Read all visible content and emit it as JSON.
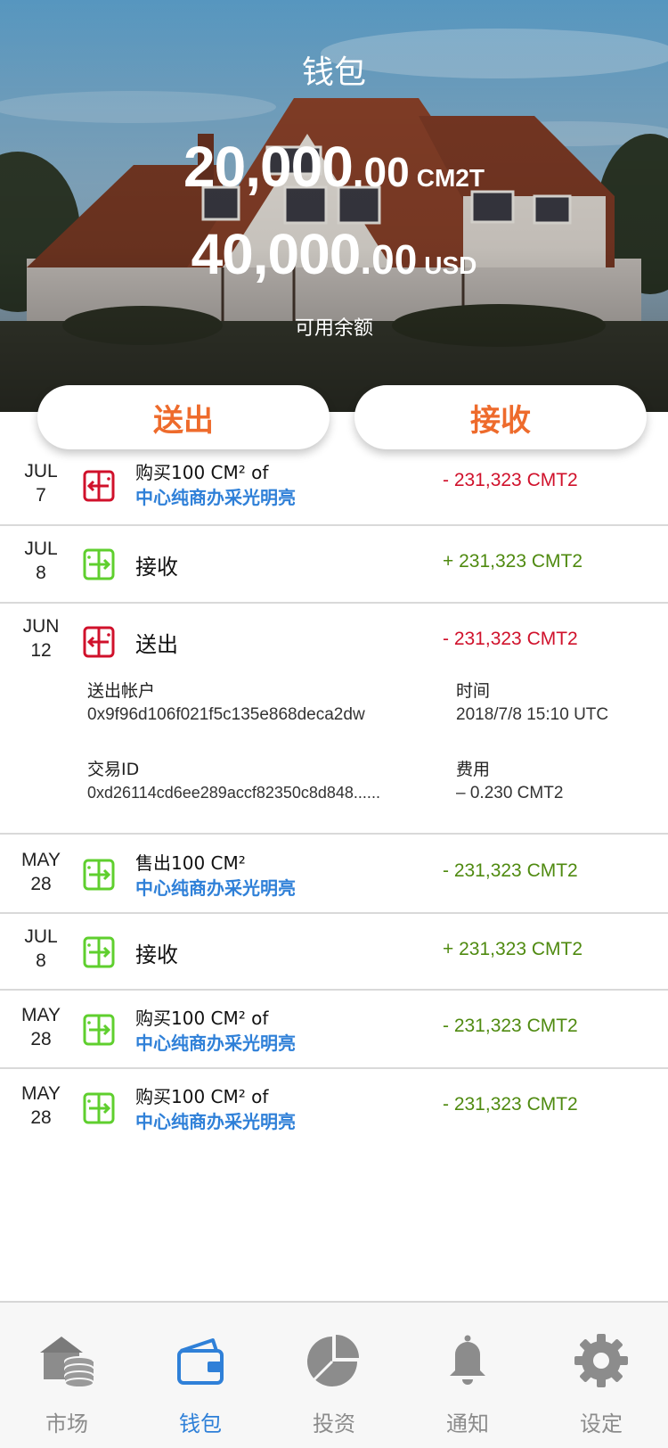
{
  "header": {
    "title": "钱包",
    "balance_token_int": "20,000",
    "balance_token_dec": ".00",
    "balance_token_unit": "CM2T",
    "balance_usd_int": "40,000",
    "balance_usd_dec": ".00",
    "balance_usd_unit": "USD",
    "subtitle": "可用余额"
  },
  "actions": {
    "send_label": "送出",
    "receive_label": "接收"
  },
  "transactions": [
    {
      "month": "JUL",
      "day": "7",
      "type": "send",
      "title": "购买100 CM² of",
      "subtitle": "中心纯商办采光明亮",
      "amount": "- 231,323 CMT2",
      "color": "#d0112b"
    },
    {
      "month": "JUL",
      "day": "8",
      "type": "receive",
      "title": "接收",
      "subtitle": "",
      "amount": "+ 231,323 CMT2",
      "color": "#4f8a10"
    },
    {
      "month": "JUN",
      "day": "12",
      "type": "send",
      "title": "送出",
      "subtitle": "",
      "amount": "- 231,323 CMT2",
      "color": "#d0112b",
      "details": {
        "from_label": "送出帐户",
        "from_value": "0x9f96d106f021f5c135e868deca2dw",
        "time_label": "时间",
        "time_value": "2018/7/8 15:10 UTC",
        "txid_label": "交易ID",
        "txid_value": "0xd26114cd6ee289accf82350c8d848......",
        "fee_label": "费用",
        "fee_value": "– 0.230 CMT2"
      }
    },
    {
      "month": "MAY",
      "day": "28",
      "type": "receive",
      "title": "售出100 CM²",
      "subtitle": "中心纯商办采光明亮",
      "amount": "- 231,323 CMT2",
      "color": "#4f8a10"
    },
    {
      "month": "JUL",
      "day": "8",
      "type": "receive",
      "title": "接收",
      "subtitle": "",
      "amount": "+ 231,323 CMT2",
      "color": "#4f8a10"
    },
    {
      "month": "MAY",
      "day": "28",
      "type": "receive",
      "title": "购买100 CM² of",
      "subtitle": "中心纯商办采光明亮",
      "amount": "- 231,323 CMT2",
      "color": "#4f8a10"
    },
    {
      "month": "MAY",
      "day": "28",
      "type": "receive",
      "title": "购买100 CM² of",
      "subtitle": "中心纯商办采光明亮",
      "amount": "- 231,323 CMT2",
      "color": "#4f8a10"
    }
  ],
  "tabbar": {
    "tabs": [
      {
        "label": "市场",
        "icon": "market-icon",
        "active": false
      },
      {
        "label": "钱包",
        "icon": "wallet-icon",
        "active": true
      },
      {
        "label": "投资",
        "icon": "pie-chart-icon",
        "active": false
      },
      {
        "label": "通知",
        "icon": "bell-icon",
        "active": false
      },
      {
        "label": "设定",
        "icon": "gear-icon",
        "active": false
      }
    ]
  },
  "colors": {
    "accent_orange": "#ee6b2c",
    "send_red": "#d0112b",
    "receive_green": "#4f8a10",
    "icon_green": "#5fcf2e",
    "link_blue": "#2f80d8",
    "tab_inactive": "#8c8c8c"
  }
}
